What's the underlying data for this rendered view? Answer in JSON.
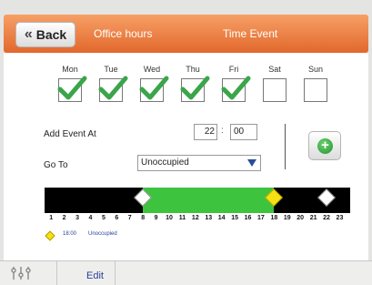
{
  "header": {
    "back_label": "Back",
    "breadcrumb_office": "Office hours",
    "breadcrumb_event": "Time Event"
  },
  "days": [
    {
      "label": "Mon",
      "checked": true
    },
    {
      "label": "Tue",
      "checked": true
    },
    {
      "label": "Wed",
      "checked": true
    },
    {
      "label": "Thu",
      "checked": true
    },
    {
      "label": "Fri",
      "checked": true
    },
    {
      "label": "Sat",
      "checked": false
    },
    {
      "label": "Sun",
      "checked": false
    }
  ],
  "form": {
    "add_event_label": "Add Event At",
    "hour": "22",
    "separator": ":",
    "minute": "00",
    "goto_label": "Go To",
    "goto_value": "Unoccupied"
  },
  "timeline": {
    "hours": [
      "1",
      "2",
      "3",
      "4",
      "5",
      "6",
      "7",
      "8",
      "9",
      "10",
      "11",
      "12",
      "13",
      "14",
      "15",
      "16",
      "17",
      "18",
      "19",
      "20",
      "21",
      "22",
      "23"
    ],
    "green_range": [
      8,
      18
    ],
    "events": [
      {
        "hour": 8,
        "kind": "white"
      },
      {
        "hour": 18,
        "kind": "yellow"
      },
      {
        "hour": 22,
        "kind": "white"
      }
    ],
    "colors": {
      "background": "#000000",
      "occupied": "#3ec33e",
      "selected": "#f4e215"
    }
  },
  "legend": {
    "time": "18:00",
    "mode": "Unoccupied"
  },
  "bottom": {
    "settings_icon": "sliders-icon",
    "edit_label": "Edit"
  },
  "colors": {
    "header_top": "#f6a066",
    "header_bottom": "#e2682c",
    "check": "#3aa54a",
    "link": "#2d3f9a"
  }
}
